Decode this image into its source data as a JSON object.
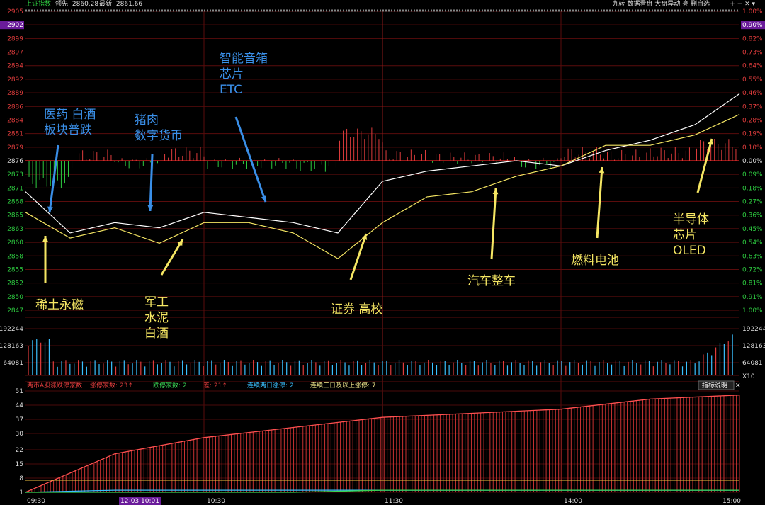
{
  "header": {
    "index_name": "上证指数",
    "lead_label": "领先: 2860.28",
    "last_label": "最新: 2861.66",
    "toolbar": "九转  数据看盘  大盘异动  亮  删自选",
    "tools": "+ − ✕ ▾"
  },
  "volume_panel": {
    "ticks": [
      "192244",
      "128163",
      "64081"
    ],
    "unit": "X10"
  },
  "breadth_panel": {
    "legend": [
      {
        "text": "两市A股涨跌停家数",
        "color": "#e03c3c"
      },
      {
        "text": "涨停家数: 23↑",
        "color": "#e03c3c"
      },
      {
        "text": "跌停家数: 2",
        "color": "#39d353"
      },
      {
        "text": "差: 21↑",
        "color": "#e03c3c"
      },
      {
        "text": "连续两日涨停: 2",
        "color": "#3ac0ff"
      },
      {
        "text": "连续三日及以上涨停: 7",
        "color": "#f0e68c"
      }
    ],
    "button": "指标说明",
    "ticks": [
      "51",
      "44",
      "37",
      "30",
      "22",
      "15",
      "8",
      "1"
    ]
  },
  "x_axis": {
    "labels": [
      "09:30",
      "12-03 10:01",
      "10:30",
      "11:30",
      "14:00",
      "15:00"
    ]
  },
  "chart_data": {
    "type": "line",
    "title": "上证指数",
    "price_ticks": [
      2905,
      2902,
      2899,
      2897,
      2894,
      2892,
      2889,
      2886,
      2884,
      2881,
      2879,
      2876,
      2873,
      2871,
      2868,
      2865,
      2863,
      2860,
      2858,
      2855,
      2852,
      2850,
      2847
    ],
    "pct_ticks": [
      "1.00%",
      "0.90%",
      "0.82%",
      "0.73%",
      "0.64%",
      "0.55%",
      "0.46%",
      "0.37%",
      "0.28%",
      "0.19%",
      "0.10%",
      "0.00%",
      "0.09%",
      "0.18%",
      "0.27%",
      "0.36%",
      "0.45%",
      "0.54%",
      "0.63%",
      "0.72%",
      "0.81%",
      "0.91%",
      "1.00%"
    ],
    "ylim": [
      2847,
      2905
    ],
    "prev_close": 2876,
    "x": [
      "09:30",
      "09:45",
      "10:00",
      "10:15",
      "10:30",
      "10:45",
      "11:00",
      "11:15",
      "11:30",
      "13:15",
      "13:30",
      "13:45",
      "14:00",
      "14:15",
      "14:30",
      "14:45",
      "15:00"
    ],
    "series": [
      {
        "name": "领先",
        "color": "#ffffff",
        "values": [
          2870,
          2862,
          2864,
          2863,
          2866,
          2865,
          2864,
          2862,
          2872,
          2874,
          2875,
          2876,
          2875,
          2878,
          2880,
          2883,
          2889
        ]
      },
      {
        "name": "最新",
        "color": "#f5e663",
        "values": [
          2866,
          2861,
          2863,
          2860,
          2864,
          2864,
          2862,
          2857,
          2864,
          2869,
          2870,
          2873,
          2875,
          2879,
          2879,
          2881,
          2885
        ]
      }
    ],
    "breadth": {
      "x": [
        "09:30",
        "10:00",
        "10:30",
        "11:00",
        "11:30",
        "13:30",
        "14:00",
        "14:30",
        "15:00"
      ],
      "limit_up": [
        1,
        20,
        28,
        33,
        38,
        40,
        42,
        47,
        49
      ],
      "limit_down": [
        1,
        1,
        1,
        1,
        2,
        2,
        2,
        2,
        2
      ],
      "two_day": [
        1,
        2,
        2,
        2,
        2,
        2,
        2,
        2,
        2
      ],
      "three_day": [
        7,
        7,
        7,
        7,
        7,
        7,
        7,
        7,
        7
      ]
    },
    "annotations": [
      {
        "text": "医药 白酒\n板块普跌",
        "color": "#3a8fe8"
      },
      {
        "text": "猪肉\n数字货币",
        "color": "#3a8fe8"
      },
      {
        "text": "智能音箱\n芯片\nETC",
        "color": "#3a8fe8"
      },
      {
        "text": "稀土永磁",
        "color": "#f5e663"
      },
      {
        "text": "军工\n水泥\n白酒",
        "color": "#f5e663"
      },
      {
        "text": "证券 高校",
        "color": "#f5e663"
      },
      {
        "text": "汽车整车",
        "color": "#f5e663"
      },
      {
        "text": "燃料电池",
        "color": "#f5e663"
      },
      {
        "text": "半导体\n芯片\nOLED",
        "color": "#f5e663"
      }
    ]
  }
}
